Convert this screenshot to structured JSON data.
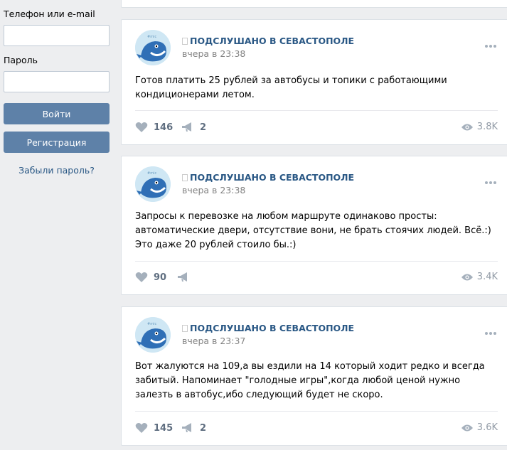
{
  "login": {
    "phone_label": "Телефон или e-mail",
    "password_label": "Пароль",
    "login_button": "Войти",
    "register_button": "Регистрация",
    "forgot_link": "Забыли пароль?"
  },
  "posts": [
    {
      "author": "ПОДСЛУШАНО В СЕВАСТОПОЛЕ",
      "date": "вчера в 23:38",
      "text": "Готов платить 25 рублей за автобусы и топики с работающими кондиционерами летом.",
      "likes": "146",
      "shares": "2",
      "views": "3.8K"
    },
    {
      "author": "ПОДСЛУШАНО В СЕВАСТОПОЛЕ",
      "date": "вчера в 23:38",
      "text": "Запросы к перевозке на любом маршруте одинаково просты: автоматические двери, отсутствие вони, не брать стоячих людей. Всё.:) Это даже 20 рублей стоило бы.:)",
      "likes": "90",
      "shares": "",
      "views": "3.4K"
    },
    {
      "author": "ПОДСЛУШАНО В СЕВАСТОПОЛЕ",
      "date": "вчера в 23:37",
      "text": "Вот жалуются на 109,а вы ездили на 14 который ходит редко и всегда забитый. Напоминает \"голодные игры\",когда любой ценой нужно залезть в автобус,ибо следующий будет не скоро.",
      "likes": "145",
      "shares": "2",
      "views": "3.6K"
    }
  ],
  "avatar_badge": "#mic",
  "colors": {
    "accent": "#5e81a8",
    "link": "#2a5885",
    "background": "#edeef0"
  },
  "icons": [
    "heart-icon",
    "megaphone-icon",
    "eye-icon",
    "more-dots-icon"
  ]
}
